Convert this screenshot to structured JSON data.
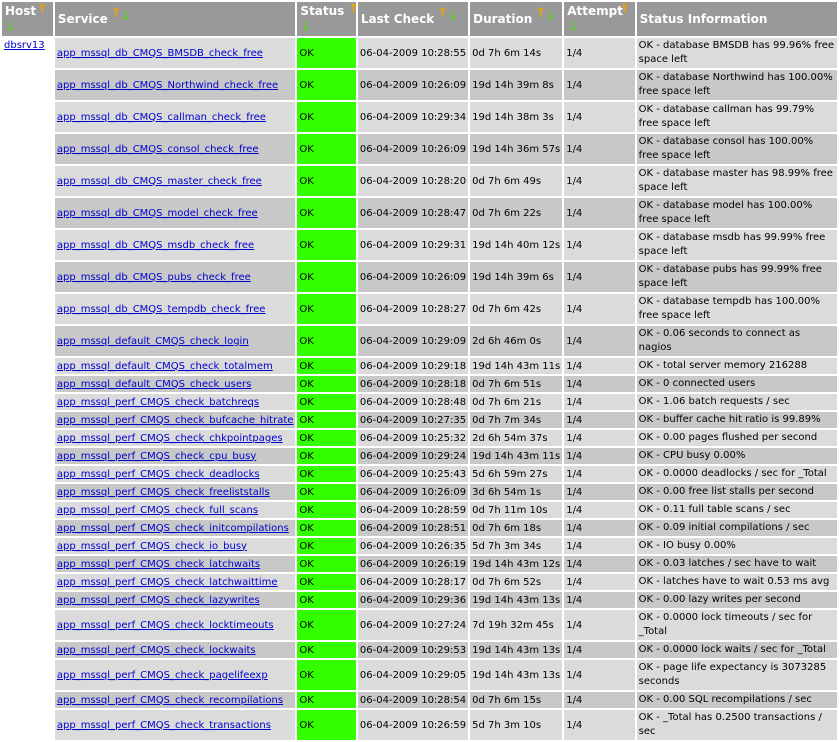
{
  "columns": {
    "host": "Host",
    "service": "Service",
    "status": "Status",
    "last_check": "Last Check",
    "duration": "Duration",
    "attempt": "Attempt",
    "status_info": "Status Information"
  },
  "sort_icons": {
    "ascending": "sort-ascending-icon",
    "descending": "sort-descending-icon"
  },
  "colors": {
    "header_bg": "#999999",
    "ok_bg": "#33ff00",
    "row_even": "#dbdbdb",
    "row_odd": "#c8c8c8",
    "link": "#0000cc"
  },
  "host": "dbsrv13",
  "rows": [
    {
      "service": "app_mssql_db_CMQS_BMSDB_check_free",
      "status": "OK",
      "last_check": "06-04-2009 10:28:55",
      "duration": "0d 7h 6m 14s",
      "attempt": "1/4",
      "info": "OK - database BMSDB has 99.96% free space left",
      "tall": true
    },
    {
      "service": "app_mssql_db_CMQS_Northwind_check_free",
      "status": "OK",
      "last_check": "06-04-2009 10:26:09",
      "duration": "19d 14h 39m 8s",
      "attempt": "1/4",
      "info": "OK - database Northwind has 100.00% free space left",
      "tall": true
    },
    {
      "service": "app_mssql_db_CMQS_callman_check_free",
      "status": "OK",
      "last_check": "06-04-2009 10:29:34",
      "duration": "19d 14h 38m 3s",
      "attempt": "1/4",
      "info": "OK - database callman has 99.79% free space left",
      "tall": true
    },
    {
      "service": "app_mssql_db_CMQS_consol_check_free",
      "status": "OK",
      "last_check": "06-04-2009 10:26:09",
      "duration": "19d 14h 36m 57s",
      "attempt": "1/4",
      "info": "OK - database consol has 100.00% free space left",
      "tall": true
    },
    {
      "service": "app_mssql_db_CMQS_master_check_free",
      "status": "OK",
      "last_check": "06-04-2009 10:28:20",
      "duration": "0d 7h 6m 49s",
      "attempt": "1/4",
      "info": "OK - database master has 98.99% free space left",
      "tall": true
    },
    {
      "service": "app_mssql_db_CMQS_model_check_free",
      "status": "OK",
      "last_check": "06-04-2009 10:28:47",
      "duration": "0d 7h 6m 22s",
      "attempt": "1/4",
      "info": "OK - database model has 100.00% free space left",
      "tall": true
    },
    {
      "service": "app_mssql_db_CMQS_msdb_check_free",
      "status": "OK",
      "last_check": "06-04-2009 10:29:31",
      "duration": "19d 14h 40m 12s",
      "attempt": "1/4",
      "info": "OK - database msdb has 99.99% free space left",
      "tall": true
    },
    {
      "service": "app_mssql_db_CMQS_pubs_check_free",
      "status": "OK",
      "last_check": "06-04-2009 10:26:09",
      "duration": "19d 14h 39m 6s",
      "attempt": "1/4",
      "info": "OK - database pubs has 99.99% free space left",
      "tall": true
    },
    {
      "service": "app_mssql_db_CMQS_tempdb_check_free",
      "status": "OK",
      "last_check": "06-04-2009 10:28:27",
      "duration": "0d 7h 6m 42s",
      "attempt": "1/4",
      "info": "OK - database tempdb has 100.00% free space left",
      "tall": true
    },
    {
      "service": "app_mssql_default_CMQS_check_login",
      "status": "OK",
      "last_check": "06-04-2009 10:29:09",
      "duration": "2d 6h 46m 0s",
      "attempt": "1/4",
      "info": "OK - 0.06 seconds to connect as nagios",
      "tall": false
    },
    {
      "service": "app_mssql_default_CMQS_check_totalmem",
      "status": "OK",
      "last_check": "06-04-2009 10:29:18",
      "duration": "19d 14h 43m 11s",
      "attempt": "1/4",
      "info": "OK - total server memory 216288",
      "tall": false
    },
    {
      "service": "app_mssql_default_CMQS_check_users",
      "status": "OK",
      "last_check": "06-04-2009 10:28:18",
      "duration": "0d 7h 6m 51s",
      "attempt": "1/4",
      "info": "OK - 0 connected users",
      "tall": false
    },
    {
      "service": "app_mssql_perf_CMQS_check_batchreqs",
      "status": "OK",
      "last_check": "06-04-2009 10:28:48",
      "duration": "0d 7h 6m 21s",
      "attempt": "1/4",
      "info": "OK - 1.06 batch requests / sec",
      "tall": false
    },
    {
      "service": "app_mssql_perf_CMQS_check_bufcache_hitrate",
      "status": "OK",
      "last_check": "06-04-2009 10:27:35",
      "duration": "0d 7h 7m 34s",
      "attempt": "1/4",
      "info": "OK - buffer cache hit ratio is 99.89%",
      "tall": false
    },
    {
      "service": "app_mssql_perf_CMQS_check_chkpointpages",
      "status": "OK",
      "last_check": "06-04-2009 10:25:32",
      "duration": "2d 6h 54m 37s",
      "attempt": "1/4",
      "info": "OK - 0.00 pages flushed per second",
      "tall": false
    },
    {
      "service": "app_mssql_perf_CMQS_check_cpu_busy",
      "status": "OK",
      "last_check": "06-04-2009 10:29:24",
      "duration": "19d 14h 43m 11s",
      "attempt": "1/4",
      "info": "OK - CPU busy 0.00%",
      "tall": false
    },
    {
      "service": "app_mssql_perf_CMQS_check_deadlocks",
      "status": "OK",
      "last_check": "06-04-2009 10:25:43",
      "duration": "5d 6h 59m 27s",
      "attempt": "1/4",
      "info": "OK - 0.0000 deadlocks / sec for _Total",
      "tall": false
    },
    {
      "service": "app_mssql_perf_CMQS_check_freeliststalls",
      "status": "OK",
      "last_check": "06-04-2009 10:26:09",
      "duration": "3d 6h 54m 1s",
      "attempt": "1/4",
      "info": "OK - 0.00 free list stalls per second",
      "tall": false
    },
    {
      "service": "app_mssql_perf_CMQS_check_full_scans",
      "status": "OK",
      "last_check": "06-04-2009 10:28:59",
      "duration": "0d 7h 11m 10s",
      "attempt": "1/4",
      "info": "OK - 0.11 full table scans / sec",
      "tall": false
    },
    {
      "service": "app_mssql_perf_CMQS_check_initcompilations",
      "status": "OK",
      "last_check": "06-04-2009 10:28:51",
      "duration": "0d 7h 6m 18s",
      "attempt": "1/4",
      "info": "OK - 0.09 initial compilations / sec",
      "tall": false
    },
    {
      "service": "app_mssql_perf_CMQS_check_io_busy",
      "status": "OK",
      "last_check": "06-04-2009 10:26:35",
      "duration": "5d 7h 3m 34s",
      "attempt": "1/4",
      "info": "OK - IO busy 0.00%",
      "tall": false
    },
    {
      "service": "app_mssql_perf_CMQS_check_latchwaits",
      "status": "OK",
      "last_check": "06-04-2009 10:26:19",
      "duration": "19d 14h 43m 12s",
      "attempt": "1/4",
      "info": "OK - 0.03 latches / sec have to wait",
      "tall": false
    },
    {
      "service": "app_mssql_perf_CMQS_check_latchwaittime",
      "status": "OK",
      "last_check": "06-04-2009 10:28:17",
      "duration": "0d 7h 6m 52s",
      "attempt": "1/4",
      "info": "OK - latches have to wait 0.53 ms avg",
      "tall": false
    },
    {
      "service": "app_mssql_perf_CMQS_check_lazywrites",
      "status": "OK",
      "last_check": "06-04-2009 10:29:36",
      "duration": "19d 14h 43m 13s",
      "attempt": "1/4",
      "info": "OK - 0.00 lazy writes per second",
      "tall": false
    },
    {
      "service": "app_mssql_perf_CMQS_check_locktimeouts",
      "status": "OK",
      "last_check": "06-04-2009 10:27:24",
      "duration": "7d 19h 32m 45s",
      "attempt": "1/4",
      "info": "OK - 0.0000 lock timeouts / sec for _Total",
      "tall": false
    },
    {
      "service": "app_mssql_perf_CMQS_check_lockwaits",
      "status": "OK",
      "last_check": "06-04-2009 10:29:53",
      "duration": "19d 14h 43m 13s",
      "attempt": "1/4",
      "info": "OK - 0.0000 lock waits / sec for _Total",
      "tall": false
    },
    {
      "service": "app_mssql_perf_CMQS_check_pagelifeexp",
      "status": "OK",
      "last_check": "06-04-2009 10:29:05",
      "duration": "19d 14h 43m 13s",
      "attempt": "1/4",
      "info": "OK - page life expectancy is 3073285 seconds",
      "tall": true
    },
    {
      "service": "app_mssql_perf_CMQS_check_recompilations",
      "status": "OK",
      "last_check": "06-04-2009 10:28:54",
      "duration": "0d 7h 6m 15s",
      "attempt": "1/4",
      "info": "OK - 0.00 SQL recompilations / sec",
      "tall": false
    },
    {
      "service": "app_mssql_perf_CMQS_check_transactions",
      "status": "OK",
      "last_check": "06-04-2009 10:26:59",
      "duration": "5d 7h 3m 10s",
      "attempt": "1/4",
      "info": "OK - _Total has 0.2500 transactions / sec",
      "tall": false
    }
  ]
}
